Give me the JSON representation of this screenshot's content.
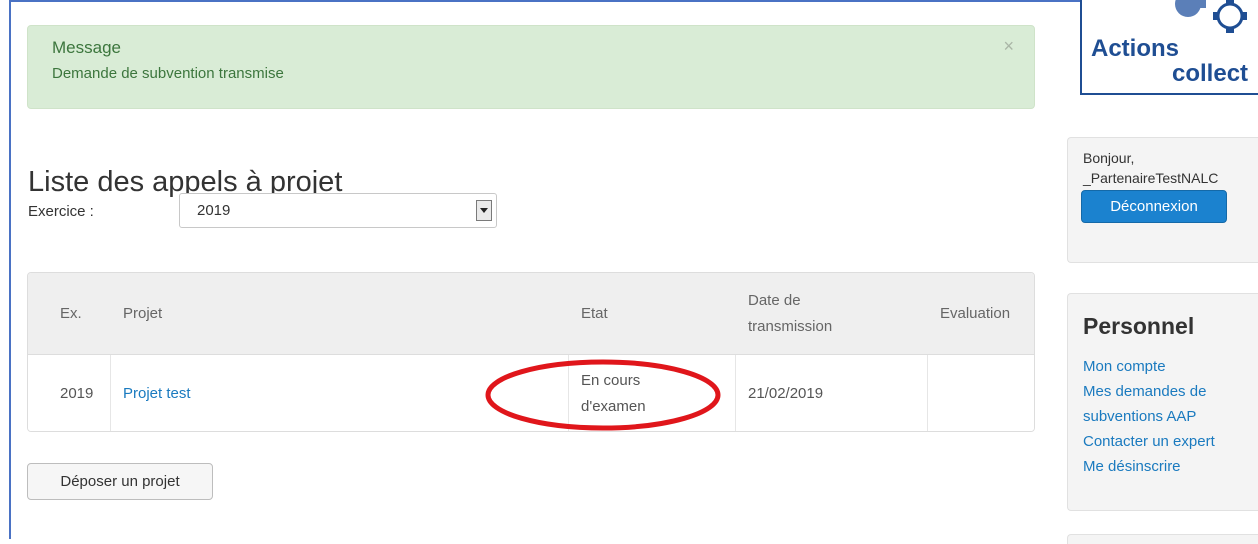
{
  "alert": {
    "title": "Message",
    "text": "Demande de subvention transmise",
    "close_glyph": "×"
  },
  "page": {
    "title": "Liste des appels à projet"
  },
  "filter": {
    "label": "Exercice :",
    "value": "2019"
  },
  "table": {
    "headers": {
      "ex": "Ex.",
      "projet": "Projet",
      "etat": "Etat",
      "date_line1": "Date de",
      "date_line2": "transmission",
      "evaluation": "Evaluation"
    },
    "rows": [
      {
        "ex": "2019",
        "projet": "Projet test",
        "etat_line1": "En cours",
        "etat_line2": "d'examen",
        "date": "21/02/2019",
        "evaluation": ""
      }
    ]
  },
  "actions": {
    "deposer_label": "Déposer un projet"
  },
  "logo": {
    "word1": "Actions",
    "word2": "collect"
  },
  "user_panel": {
    "greeting": "Bonjour,",
    "username": "_PartenaireTestNALC",
    "logout_label": "Déconnexion"
  },
  "personnel": {
    "title": "Personnel",
    "links": [
      "Mon compte",
      "Mes demandes de",
      "subventions AAP",
      "Contacter un expert",
      "Me désinscrire"
    ]
  },
  "colors": {
    "link": "#1a7abf",
    "alert_bg": "#d9ecd6",
    "alert_text": "#3c763d",
    "primary_button": "#1b82cf",
    "annotation": "#e0161b",
    "frame": "#4a72c4"
  },
  "icons": {
    "alert_close": "close-icon",
    "select_arrow": "chevron-down-icon",
    "logo_gear": "gear-icon"
  }
}
